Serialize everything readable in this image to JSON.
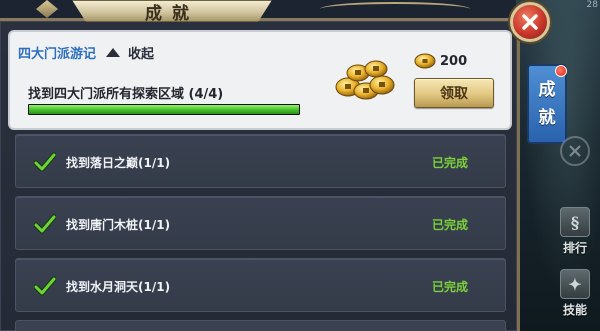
{
  "window": {
    "title": "成就",
    "counter": "28"
  },
  "side_tabs": {
    "achievement_char1": "成",
    "achievement_char2": "就",
    "rank_label": "排行",
    "skill_label": "技能"
  },
  "main_card": {
    "title": "四大门派游记",
    "collapse_label": "收起",
    "task": "找到四大门派所有探索区域 (4/4)",
    "progress": 1.0,
    "reward_amount": "200",
    "claim_label": "领取"
  },
  "sub_tasks": [
    {
      "label": "找到落日之巅(1/1)",
      "status": "已完成"
    },
    {
      "label": "找到唐门木桩(1/1)",
      "status": "已完成"
    },
    {
      "label": "找到水月洞天(1/1)",
      "status": "已完成"
    }
  ],
  "colors": {
    "progress_green": "#43bf2a",
    "completed_green": "#7bd13a",
    "title_blue": "#2d6fbf",
    "tab_blue": "#2a62ad",
    "close_red": "#c8372b"
  },
  "icons": {
    "close": "close-icon",
    "collapse": "caret-up-icon",
    "coin_pile": "coin-pile-icon",
    "coin": "coin-icon",
    "check": "check-icon"
  }
}
